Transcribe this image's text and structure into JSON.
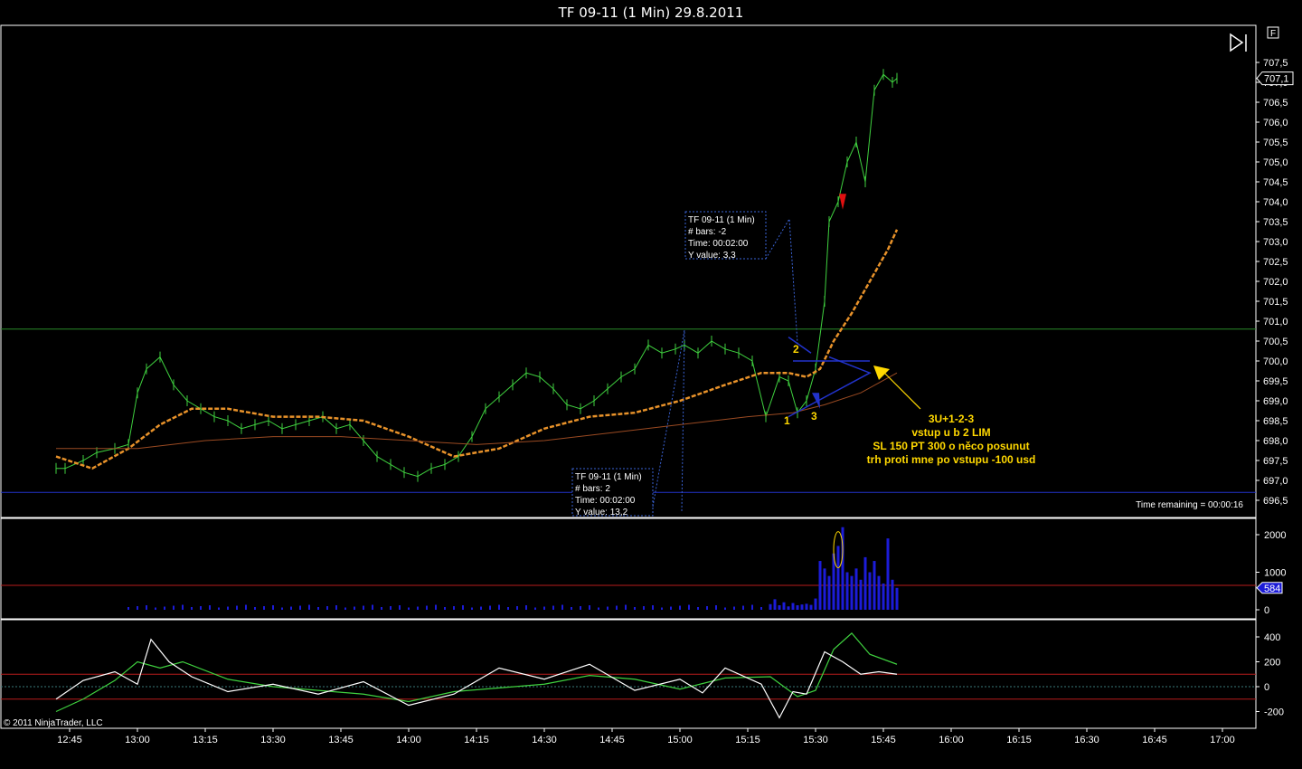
{
  "window": {
    "title": "TF 09-11 (1 Min)  29.8.2011",
    "f_button": "F",
    "copyright": "© 2011 NinjaTrader, LLC"
  },
  "colors": {
    "price": "#3fd13f",
    "ema_fast": "#e8922a",
    "ema_slow": "#9a4a22",
    "volume": "#1c1cd8",
    "level_green": "#2a8a2a",
    "level_blue": "#2233cc",
    "osc_green": "#3fd13f",
    "osc_white": "#ffffff",
    "osc_red": "#b81c1c",
    "annotation": "#ffd800"
  },
  "chart_data": [
    {
      "panel": "price",
      "type": "line",
      "instrument": "TF 09-11 (1 Min)",
      "date": "29.8.2011",
      "y_ticks": [
        "707,5",
        "707,0",
        "706,5",
        "706,0",
        "705,5",
        "705,0",
        "704,5",
        "704,0",
        "703,5",
        "703,0",
        "702,5",
        "702,0",
        "701,5",
        "701,0",
        "700,5",
        "700,0",
        "699,5",
        "699,0",
        "698,5",
        "698,0",
        "697,5",
        "697,0",
        "696,5"
      ],
      "ylim": [
        696.5,
        708.0
      ],
      "x_ticks": [
        "12:45",
        "13:00",
        "13:15",
        "13:30",
        "13:45",
        "14:00",
        "14:15",
        "14:30",
        "14:45",
        "15:00",
        "15:15",
        "15:30",
        "15:45",
        "16:00",
        "16:15",
        "16:30",
        "16:45",
        "17:00"
      ],
      "last_price_label": "707,1",
      "horizontal_lines": {
        "green": 700.8,
        "blue": 696.7
      },
      "series": [
        {
          "name": "",
          "kind": "price",
          "x": [
            "12:42",
            "12:44",
            "12:48",
            "12:51",
            "12:55",
            "12:58",
            "13:00",
            "13:02",
            "13:05",
            "13:08",
            "13:11",
            "13:14",
            "13:17",
            "13:20",
            "13:23",
            "13:26",
            "13:29",
            "13:32",
            "13:35",
            "13:38",
            "13:41",
            "13:44",
            "13:47",
            "13:50",
            "13:53",
            "13:56",
            "13:59",
            "14:02",
            "14:05",
            "14:08",
            "14:11",
            "14:14",
            "14:17",
            "14:20",
            "14:23",
            "14:26",
            "14:29",
            "14:32",
            "14:35",
            "14:38",
            "14:41",
            "14:44",
            "14:47",
            "14:50",
            "14:53",
            "14:56",
            "14:59",
            "15:01",
            "15:04",
            "15:07",
            "15:10",
            "15:13",
            "15:16",
            "15:19",
            "15:22",
            "15:24",
            "15:26",
            "15:28",
            "15:30",
            "15:32",
            "15:33",
            "15:35",
            "15:37",
            "15:39",
            "15:41",
            "15:43",
            "15:45",
            "15:47",
            "15:48"
          ],
          "values": [
            697.3,
            697.3,
            697.5,
            697.7,
            697.8,
            697.9,
            699.2,
            699.8,
            700.1,
            699.4,
            699.0,
            698.8,
            698.6,
            698.5,
            698.3,
            698.4,
            698.5,
            698.3,
            698.4,
            698.5,
            698.6,
            698.3,
            698.4,
            698.0,
            697.6,
            697.4,
            697.2,
            697.1,
            697.3,
            697.4,
            697.6,
            698.1,
            698.8,
            699.1,
            699.4,
            699.7,
            699.6,
            699.3,
            698.9,
            698.8,
            699.0,
            699.3,
            699.6,
            699.8,
            700.4,
            700.2,
            700.3,
            700.4,
            700.2,
            700.5,
            700.3,
            700.2,
            700.0,
            698.6,
            699.6,
            699.5,
            698.7,
            699.0,
            699.8,
            701.5,
            703.5,
            704.0,
            705.0,
            705.5,
            704.5,
            706.8,
            707.2,
            707.0,
            707.1
          ]
        },
        {
          "name": "",
          "kind": "ema_fast",
          "x": [
            "12:42",
            "12:50",
            "12:58",
            "13:05",
            "13:12",
            "13:20",
            "13:30",
            "13:40",
            "13:50",
            "14:00",
            "14:10",
            "14:20",
            "14:30",
            "14:40",
            "14:50",
            "15:00",
            "15:10",
            "15:18",
            "15:24",
            "15:28",
            "15:31",
            "15:34",
            "15:38",
            "15:42",
            "15:46",
            "15:48"
          ],
          "values": [
            697.6,
            697.3,
            697.8,
            698.4,
            698.8,
            698.8,
            698.6,
            698.6,
            698.5,
            698.1,
            697.6,
            697.8,
            698.3,
            698.6,
            698.7,
            699.0,
            699.4,
            699.7,
            699.7,
            699.6,
            699.8,
            700.5,
            701.2,
            702.0,
            702.8,
            703.3
          ]
        },
        {
          "name": "",
          "kind": "ema_slow",
          "x": [
            "12:42",
            "13:00",
            "13:15",
            "13:30",
            "13:45",
            "14:00",
            "14:15",
            "14:30",
            "14:45",
            "15:00",
            "15:15",
            "15:25",
            "15:32",
            "15:40",
            "15:48"
          ],
          "values": [
            697.8,
            697.8,
            698.0,
            698.1,
            698.1,
            698.0,
            697.9,
            698.0,
            698.2,
            698.4,
            698.6,
            698.7,
            698.9,
            699.2,
            699.7
          ]
        }
      ],
      "annotations": {
        "info_box_1": [
          "TF 09-11 (1 Min)",
          "# bars:   -2",
          "Time:     00:02:00",
          "Y value: 3,3"
        ],
        "info_box_2": [
          "TF 09-11 (1 Min)",
          "# bars:   2",
          "Time:     00:02:00",
          "Y value: 13,2"
        ],
        "swing_labels": [
          "1",
          "2",
          "3"
        ],
        "trade_note": [
          "3U+1-2-3",
          "vstup u b 2 LIM",
          "SL 150 PT 300 o něco posunut",
          "trh proti mne po vstupu -100 usd"
        ],
        "time_remaining": "Time remaining = 00:00:16"
      }
    },
    {
      "panel": "volume",
      "type": "bar",
      "y_ticks": [
        "2000",
        "1000",
        "0"
      ],
      "ylim": [
        0,
        2400
      ],
      "last_value_label": "584",
      "reference_line": 650,
      "x": [
        "15:20",
        "15:21",
        "15:22",
        "15:23",
        "15:24",
        "15:25",
        "15:26",
        "15:27",
        "15:28",
        "15:29",
        "15:30",
        "15:31",
        "15:32",
        "15:33",
        "15:34",
        "15:35",
        "15:36",
        "15:37",
        "15:38",
        "15:39",
        "15:40",
        "15:41",
        "15:42",
        "15:43",
        "15:44",
        "15:45",
        "15:46",
        "15:47",
        "15:48"
      ],
      "values": [
        150,
        280,
        120,
        200,
        90,
        180,
        120,
        140,
        160,
        130,
        300,
        1300,
        1100,
        900,
        1500,
        1700,
        2200,
        1000,
        900,
        1100,
        800,
        1400,
        1000,
        1300,
        900,
        700,
        1900,
        800,
        584
      ]
    },
    {
      "panel": "oscillator",
      "type": "line",
      "y_ticks": [
        "400",
        "200",
        "0",
        "-200"
      ],
      "ylim": [
        -300,
        450
      ],
      "reference_lines": [
        100,
        -100
      ],
      "series": [
        {
          "name": "",
          "kind": "osc_green",
          "x": [
            "12:42",
            "12:48",
            "12:55",
            "13:00",
            "13:05",
            "13:10",
            "13:20",
            "13:30",
            "13:40",
            "13:50",
            "14:00",
            "14:10",
            "14:20",
            "14:30",
            "14:40",
            "14:50",
            "15:00",
            "15:10",
            "15:20",
            "15:26",
            "15:30",
            "15:34",
            "15:38",
            "15:42",
            "15:48"
          ],
          "values": [
            -200,
            -100,
            50,
            200,
            150,
            200,
            60,
            0,
            -30,
            -60,
            -120,
            -40,
            -10,
            20,
            90,
            60,
            -20,
            70,
            80,
            -80,
            -30,
            300,
            430,
            260,
            180
          ]
        },
        {
          "name": "",
          "kind": "osc_white",
          "x": [
            "12:42",
            "12:48",
            "12:55",
            "13:00",
            "13:03",
            "13:07",
            "13:12",
            "13:20",
            "13:30",
            "13:40",
            "13:50",
            "14:00",
            "14:10",
            "14:20",
            "14:30",
            "14:40",
            "14:50",
            "15:00",
            "15:05",
            "15:10",
            "15:18",
            "15:22",
            "15:25",
            "15:28",
            "15:32",
            "15:36",
            "15:40",
            "15:44",
            "15:48"
          ],
          "values": [
            -100,
            50,
            120,
            20,
            380,
            200,
            80,
            -40,
            20,
            -60,
            40,
            -150,
            -60,
            150,
            60,
            180,
            -30,
            60,
            -50,
            150,
            20,
            -250,
            -40,
            -60,
            280,
            200,
            100,
            120,
            100
          ]
        }
      ]
    }
  ]
}
